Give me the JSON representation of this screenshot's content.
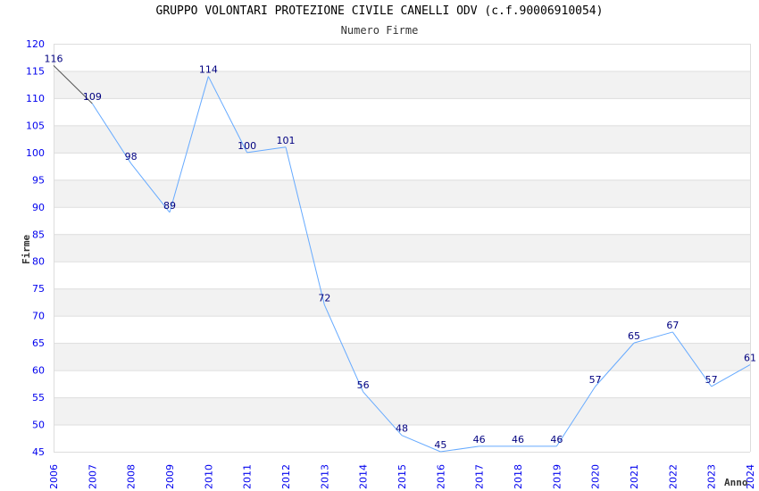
{
  "chart_data": {
    "type": "line",
    "title": "GRUPPO VOLONTARI PROTEZIONE CIVILE CANELLI ODV (c.f.90006910054)",
    "subtitle": "Numero Firme",
    "xlabel": "Anno",
    "ylabel": "Firme",
    "x": [
      "2006",
      "2007",
      "2008",
      "2009",
      "2010",
      "2011",
      "2012",
      "2013",
      "2014",
      "2015",
      "2016",
      "2017",
      "2018",
      "2019",
      "2020",
      "2021",
      "2022",
      "2023",
      "2024"
    ],
    "values": [
      116,
      109,
      98,
      89,
      114,
      100,
      101,
      72,
      56,
      48,
      45,
      46,
      46,
      46,
      57,
      65,
      67,
      57,
      61
    ],
    "ylim": [
      45,
      120
    ],
    "yticks": [
      45,
      50,
      55,
      60,
      65,
      70,
      75,
      80,
      85,
      90,
      95,
      100,
      105,
      110,
      115,
      120
    ],
    "grid": true,
    "data_labels": true,
    "colors": {
      "line": "#66aaff",
      "first_segment": "#555555",
      "tick": "#0000ee",
      "data_label": "#000080",
      "band": "#f2f2f2",
      "grid": "#dddddd"
    }
  }
}
